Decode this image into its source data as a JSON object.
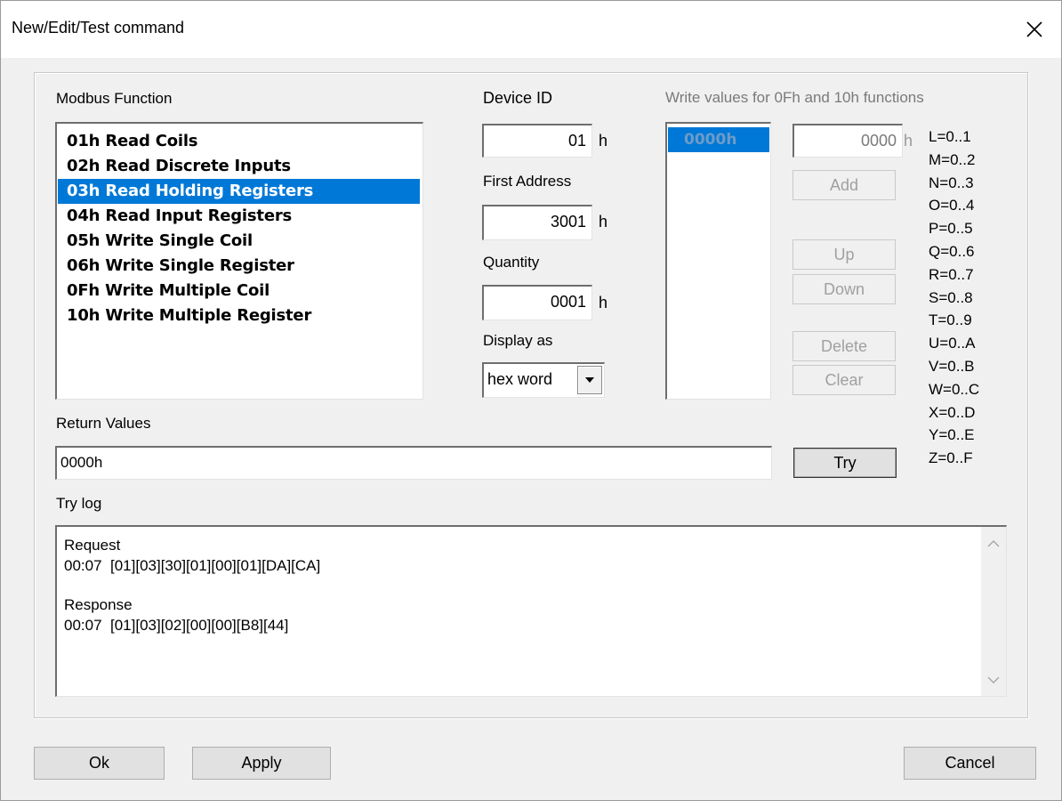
{
  "window": {
    "title": "New/Edit/Test command"
  },
  "modbus": {
    "label": "Modbus Function",
    "functions": [
      "01h  Read Coils",
      "02h  Read Discrete Inputs",
      "03h  Read Holding Registers",
      "04h  Read Input Registers",
      "05h  Write Single Coil",
      "06h  Write Single Register",
      "0Fh  Write Multiple Coil",
      "10h  Write Multiple Register"
    ],
    "selected_index": 2
  },
  "device": {
    "device_id_label": "Device ID",
    "device_id_value": "01",
    "first_address_label": "First Address",
    "first_address_value": "3001",
    "quantity_label": "Quantity",
    "quantity_value": "0001",
    "hex_suffix": "h",
    "display_as_label": "Display as",
    "display_as_value": "hex word"
  },
  "write_values": {
    "label": "Write values for 0Fh and 10h functions",
    "items": [
      "0000h"
    ],
    "input_value": "0000",
    "input_suffix": "h",
    "buttons": {
      "add": "Add",
      "up": "Up",
      "down": "Down",
      "delete": "Delete",
      "clear": "Clear"
    }
  },
  "legend": [
    "L=0..1",
    "M=0..2",
    "N=0..3",
    "O=0..4",
    "P=0..5",
    "Q=0..6",
    "R=0..7",
    "S=0..8",
    "T=0..9",
    "U=0..A",
    "V=0..B",
    "W=0..C",
    "X=0..D",
    "Y=0..E",
    "Z=0..F"
  ],
  "return_values": {
    "label": "Return Values",
    "value": "0000h"
  },
  "try_button": "Try",
  "try_log": {
    "label": "Try log",
    "lines": [
      "Request",
      "00:07  [01][03][30][01][00][01][DA][CA]",
      "",
      "Response",
      "00:07  [01][03][02][00][00][B8][44]"
    ]
  },
  "footer": {
    "ok": "Ok",
    "apply": "Apply",
    "cancel": "Cancel"
  },
  "colors": {
    "selection": "#0078d7",
    "dialog_bg": "#f0f0f0",
    "disabled_text": "#a0a0a0"
  }
}
